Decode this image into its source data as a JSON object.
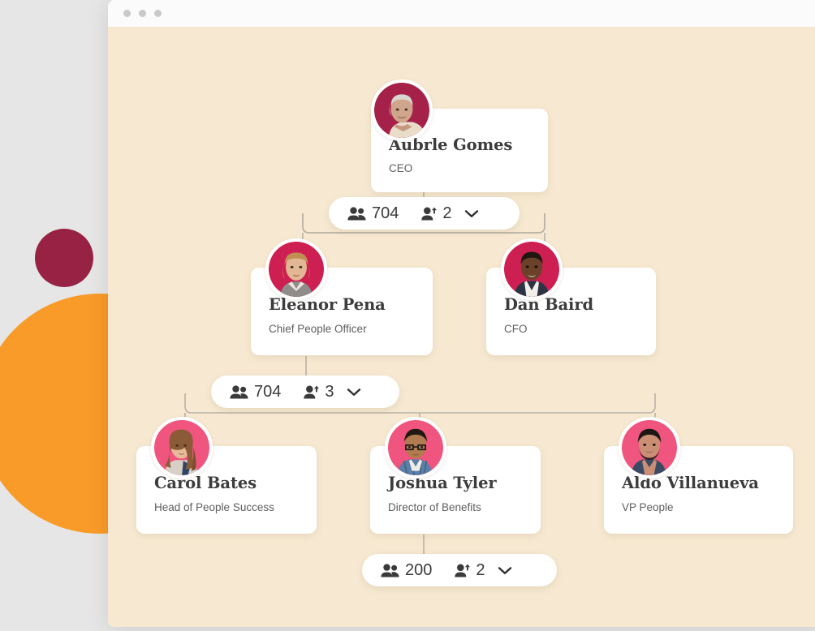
{
  "window": {
    "title_bar": {
      "dots": [
        "window-dot-1",
        "window-dot-2",
        "window-dot-3"
      ],
      "dot_color": "#C9C9C9"
    },
    "canvas_color": "#F7E9D1"
  },
  "decor": {
    "maroon_circle_color": "#972243",
    "orange_circle_color": "#F99B28",
    "page_background": "#E6E6E6"
  },
  "org_chart": {
    "type": "org-tree",
    "levels": [
      {
        "level": 1,
        "nodes": [
          {
            "name": "Aubrle Gomes",
            "role": "CEO",
            "avatar_bg": "#A6214A",
            "avatar_id": "avatar-aubrle-gomes"
          }
        ]
      },
      {
        "level": 2,
        "nodes": [
          {
            "name": "Eleanor Pena",
            "role": "Chief People Officer",
            "avatar_bg": "#CE1F52",
            "avatar_id": "avatar-eleanor-pena"
          },
          {
            "name": "Dan Baird",
            "role": "CFO",
            "avatar_bg": "#CE1F52",
            "avatar_id": "avatar-dan-baird"
          }
        ]
      },
      {
        "level": 3,
        "nodes": [
          {
            "name": "Carol Bates",
            "role": "Head of People Success",
            "avatar_bg": "#EF557E",
            "avatar_id": "avatar-carol-bates"
          },
          {
            "name": "Joshua Tyler",
            "role": "Director of Benefits",
            "avatar_bg": "#EF557E",
            "avatar_id": "avatar-joshua-tyler"
          },
          {
            "name": "Aldo Villanueva",
            "role": "VP People",
            "avatar_bg": "#EF557E",
            "avatar_id": "avatar-aldo-villanueva"
          }
        ]
      }
    ],
    "pills": [
      {
        "id": "pill-level-1",
        "people_icon": "people-group-icon",
        "people_count": "704",
        "reports_icon": "person-up-arrow-icon",
        "reports_count": "2",
        "chevron": "chevron-down-icon"
      },
      {
        "id": "pill-level-2",
        "people_icon": "people-group-icon",
        "people_count": "704",
        "reports_icon": "person-up-arrow-icon",
        "reports_count": "3",
        "chevron": "chevron-down-icon"
      },
      {
        "id": "pill-level-3",
        "people_icon": "people-group-icon",
        "people_count": "200",
        "reports_icon": "person-up-arrow-icon",
        "reports_count": "2",
        "chevron": "chevron-down-icon"
      }
    ],
    "connector_color": "#B9B2A5"
  }
}
